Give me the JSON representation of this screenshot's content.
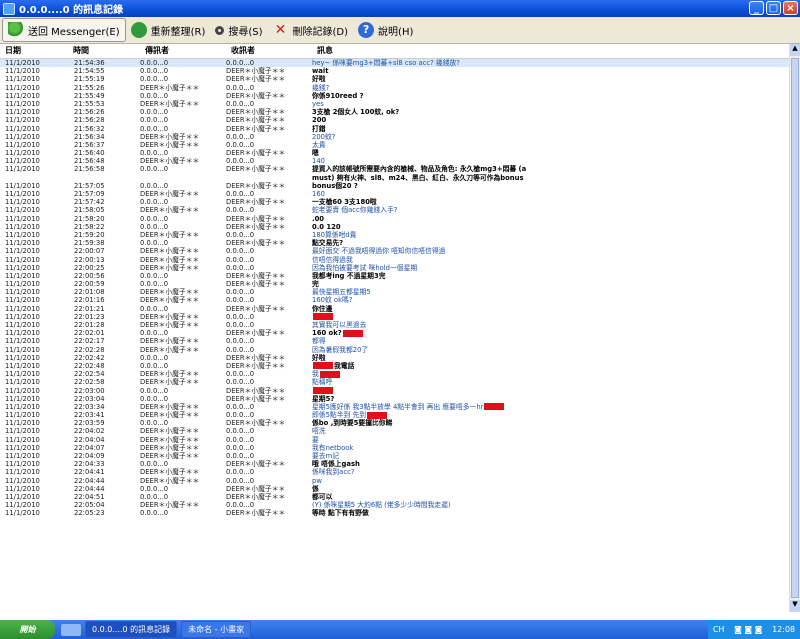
{
  "window": {
    "title": "0.0.0....0 的訊息記錄"
  },
  "toolbar": {
    "back": "送回 Messenger(E)",
    "refresh": "重新整理(R)",
    "search": "搜尋(S)",
    "delete": "刪除記錄(D)",
    "help": "說明(H)"
  },
  "columns": {
    "date": "日期",
    "time": "時間",
    "from": "傳訊者",
    "to": "收訊者",
    "msg": "訊息"
  },
  "rows": [
    {
      "d": "11/1/2010",
      "t": "21:54:36",
      "f": "0.0.0...0",
      "r": "0.0.0...0",
      "m": "hey~ 係咪要mg3+悶蕃+sl8 cso acc? 幾錢放?",
      "b": false,
      "s": true
    },
    {
      "d": "11/1/2010",
      "t": "21:54:55",
      "f": "0.0.0...0",
      "r": "DEER＊小魔子＊＊",
      "m": "wait",
      "b": true
    },
    {
      "d": "11/1/2010",
      "t": "21:55:19",
      "f": "0.0.0...0",
      "r": "DEER＊小魔子＊＊",
      "m": "好啦",
      "b": true
    },
    {
      "d": "11/1/2010",
      "t": "21:55:26",
      "f": "DEER＊小魔子＊＊",
      "r": "0.0.0...0",
      "m": "幾錢?",
      "b": false
    },
    {
      "d": "11/1/2010",
      "t": "21:55:49",
      "f": "0.0.0...0",
      "r": "DEER＊小魔子＊＊",
      "m": "你係910reed ?",
      "b": true
    },
    {
      "d": "11/1/2010",
      "t": "21:55:53",
      "f": "DEER＊小魔子＊＊",
      "r": "0.0.0...0",
      "m": "yes",
      "b": false
    },
    {
      "d": "11/1/2010",
      "t": "21:56:26",
      "f": "0.0.0...0",
      "r": "DEER＊小魔子＊＊",
      "m": "3支槍 2個女人 100蚊, ok?",
      "b": true
    },
    {
      "d": "11/1/2010",
      "t": "21:56:28",
      "f": "0.0.0...0",
      "r": "DEER＊小魔子＊＊",
      "m": "200",
      "b": true
    },
    {
      "d": "11/1/2010",
      "t": "21:56:32",
      "f": "0.0.0...0",
      "r": "DEER＊小魔子＊＊",
      "m": "打錯",
      "b": true
    },
    {
      "d": "11/1/2010",
      "t": "21:56:34",
      "f": "DEER＊小魔子＊＊",
      "r": "0.0.0...0",
      "m": "200蚊?",
      "b": false
    },
    {
      "d": "11/1/2010",
      "t": "21:56:37",
      "f": "DEER＊小魔子＊＊",
      "r": "0.0.0...0",
      "m": "太貴",
      "b": false
    },
    {
      "d": "11/1/2010",
      "t": "21:56:40",
      "f": "0.0.0...0",
      "r": "DEER＊小魔子＊＊",
      "m": "嗯",
      "b": true
    },
    {
      "d": "11/1/2010",
      "t": "21:56:48",
      "f": "DEER＊小魔子＊＊",
      "r": "0.0.0...0",
      "m": "140",
      "b": false
    },
    {
      "d": "11/1/2010",
      "t": "21:56:58",
      "f": "0.0.0...0",
      "r": "DEER＊小魔子＊＊",
      "m": "提買入的該帳號所需要內含的槍械、物品及角色: 永久槍mg3+悶蕃 (a",
      "b": true
    },
    {
      "d": "",
      "t": "",
      "f": "",
      "r": "",
      "m": "must) 夠有火神、sl8、m24、黑白、紅白、永久刀等可作為bonus",
      "b": true
    },
    {
      "d": "11/1/2010",
      "t": "21:57:05",
      "f": "0.0.0...0",
      "r": "DEER＊小魔子＊＊",
      "m": "bonus個20 ?",
      "b": true
    },
    {
      "d": "11/1/2010",
      "t": "21:57:09",
      "f": "DEER＊小魔子＊＊",
      "r": "0.0.0...0",
      "m": "160",
      "b": false
    },
    {
      "d": "11/1/2010",
      "t": "21:57:42",
      "f": "0.0.0...0",
      "r": "DEER＊小魔子＊＊",
      "m": "一支槍60 3支180啦",
      "b": true
    },
    {
      "d": "11/1/2010",
      "t": "21:58:05",
      "f": "DEER＊小魔子＊＊",
      "r": "0.0.0...0",
      "m": "蛇老要賣 個acc你幾錢入手?",
      "b": false
    },
    {
      "d": "11/1/2010",
      "t": "21:58:20",
      "f": "0.0.0...0",
      "r": "DEER＊小魔子＊＊",
      "m": ".00",
      "b": true
    },
    {
      "d": "11/1/2010",
      "t": "21:58:22",
      "f": "0.0.0...0",
      "r": "DEER＊小魔子＊＊",
      "m": "0.0 120",
      "b": true
    },
    {
      "d": "11/1/2010",
      "t": "21:59:20",
      "f": "DEER＊小魔子＊＊",
      "r": "0.0.0...0",
      "m": "180算係咁d貴",
      "b": false
    },
    {
      "d": "11/1/2010",
      "t": "21:59:38",
      "f": "0.0.0...0",
      "r": "DEER＊小魔子＊＊",
      "m": "點交易先?",
      "b": true
    },
    {
      "d": "11/1/2010",
      "t": "22:00:07",
      "f": "DEER＊小魔子＊＊",
      "r": "0.0.0...0",
      "m": "最好面交 不過我唔得過你 唔知你信唔信得過",
      "b": false
    },
    {
      "d": "11/1/2010",
      "t": "22:00:13",
      "f": "DEER＊小魔子＊＊",
      "r": "0.0.0...0",
      "m": "信唔信得過我",
      "b": false
    },
    {
      "d": "11/1/2010",
      "t": "22:00:25",
      "f": "DEER＊小魔子＊＊",
      "r": "0.0.0...0",
      "m": "因為我怕被要考試 咪hold一個星期",
      "b": false
    },
    {
      "d": "11/1/2010",
      "t": "22:00:56",
      "f": "0.0.0...0",
      "r": "DEER＊小魔子＊＊",
      "m": "我都考ing 不過星期3完",
      "b": true
    },
    {
      "d": "11/1/2010",
      "t": "22:00:59",
      "f": "0.0.0...0",
      "r": "DEER＊小魔子＊＊",
      "m": "完",
      "b": true
    },
    {
      "d": "11/1/2010",
      "t": "22:01:08",
      "f": "DEER＊小魔子＊＊",
      "r": "0.0.0...0",
      "m": "最快星期五都星期5",
      "b": false
    },
    {
      "d": "11/1/2010",
      "t": "22:01:16",
      "f": "DEER＊小魔子＊＊",
      "r": "0.0.0...0",
      "m": "160蚊 ok嗎?",
      "b": false
    },
    {
      "d": "11/1/2010",
      "t": "22:01:21",
      "f": "0.0.0...0",
      "r": "DEER＊小魔子＊＊",
      "m": "你住邊",
      "b": true
    },
    {
      "d": "11/1/2010",
      "t": "22:01:23",
      "f": "DEER＊小魔子＊＊",
      "r": "0.0.0...0",
      "m": "",
      "x": "pre",
      "b": false
    },
    {
      "d": "11/1/2010",
      "t": "22:01:28",
      "f": "DEER＊小魔子＊＊",
      "r": "0.0.0...0",
      "m": "其實我可以黑過去",
      "b": false
    },
    {
      "d": "11/1/2010",
      "t": "22:02:01",
      "f": "0.0.0...0",
      "r": "DEER＊小魔子＊＊",
      "m": "160 ok?",
      "x": "mid",
      "b": true
    },
    {
      "d": "11/1/2010",
      "t": "22:02:17",
      "f": "DEER＊小魔子＊＊",
      "r": "0.0.0...0",
      "m": "都得",
      "b": false
    },
    {
      "d": "11/1/2010",
      "t": "22:02:28",
      "f": "DEER＊小魔子＊＊",
      "r": "0.0.0...0",
      "m": "因為暑假我都20了",
      "b": false
    },
    {
      "d": "11/1/2010",
      "t": "22:02:42",
      "f": "0.0.0...0",
      "r": "DEER＊小魔子＊＊",
      "m": "好啦",
      "b": true
    },
    {
      "d": "11/1/2010",
      "t": "22:02:48",
      "f": "0.0.0...0",
      "r": "DEER＊小魔子＊＊",
      "m": "我電話",
      "x": "pre",
      "b": true
    },
    {
      "d": "11/1/2010",
      "t": "22:02:54",
      "f": "DEER＊小魔子＊＊",
      "r": "0.0.0...0",
      "m": "我",
      "x": "post",
      "b": false
    },
    {
      "d": "11/1/2010",
      "t": "22:02:58",
      "f": "DEER＊小魔子＊＊",
      "r": "0.0.0...0",
      "m": "點稱呼",
      "b": false
    },
    {
      "d": "11/1/2010",
      "t": "22:03:00",
      "f": "0.0.0...0",
      "r": "DEER＊小魔子＊＊",
      "m": "",
      "x": "pre",
      "b": true
    },
    {
      "d": "11/1/2010",
      "t": "22:03:04",
      "f": "0.0.0...0",
      "r": "DEER＊小魔子＊＊",
      "m": "星期5?",
      "b": true
    },
    {
      "d": "11/1/2010",
      "t": "22:03:34",
      "f": "DEER＊小魔子＊＊",
      "r": "0.0.0...0",
      "m": "星期5應好係 我3點半放學 4點半會到 再出 應要唔多一hr",
      "x": "mid",
      "b": false
    },
    {
      "d": "11/1/2010",
      "t": "22:03:41",
      "f": "DEER＊小魔子＊＊",
      "r": "0.0.0...0",
      "m": "即係5點半到 先到",
      "x": "post",
      "b": false
    },
    {
      "d": "11/1/2010",
      "t": "22:03:59",
      "f": "0.0.0...0",
      "r": "DEER＊小魔子＊＊",
      "m": "係bo ,到時要5要攞比你睇",
      "b": true
    },
    {
      "d": "11/1/2010",
      "t": "22:04:02",
      "f": "DEER＊小魔子＊＊",
      "r": "0.0.0...0",
      "m": "唔洗",
      "b": false
    },
    {
      "d": "11/1/2010",
      "t": "22:04:04",
      "f": "DEER＊小魔子＊＊",
      "r": "0.0.0...0",
      "m": "要",
      "b": false
    },
    {
      "d": "11/1/2010",
      "t": "22:04:07",
      "f": "DEER＊小魔子＊＊",
      "r": "0.0.0...0",
      "m": "我有netbook",
      "b": false
    },
    {
      "d": "11/1/2010",
      "t": "22:04:09",
      "f": "DEER＊小魔子＊＊",
      "r": "0.0.0...0",
      "m": "要去m記",
      "b": false
    },
    {
      "d": "11/1/2010",
      "t": "22:04:33",
      "f": "0.0.0...0",
      "r": "DEER＊小魔子＊＊",
      "m": "哦 唔係上gash",
      "b": true
    },
    {
      "d": "11/1/2010",
      "t": "22:04:41",
      "f": "DEER＊小魔子＊＊",
      "r": "0.0.0...0",
      "m": "係咪我到acc?",
      "b": false
    },
    {
      "d": "11/1/2010",
      "t": "22:04:44",
      "f": "DEER＊小魔子＊＊",
      "r": "0.0.0...0",
      "m": "pw",
      "b": false
    },
    {
      "d": "11/1/2010",
      "t": "22:04:44",
      "f": "0.0.0...0",
      "r": "DEER＊小魔子＊＊",
      "m": "係",
      "b": true
    },
    {
      "d": "11/1/2010",
      "t": "22:04:51",
      "f": "0.0.0...0",
      "r": "DEER＊小魔子＊＊",
      "m": "都可以",
      "b": true
    },
    {
      "d": "11/1/2010",
      "t": "22:05:04",
      "f": "DEER＊小魔子＊＊",
      "r": "0.0.0...0",
      "m": "(Y) 係咪星期5 大約6點 (佬多少少時間我走遲)",
      "b": false
    },
    {
      "d": "11/1/2010",
      "t": "22:05:23",
      "f": "0.0.0...0",
      "r": "DEER＊小魔子＊＊",
      "m": "等時 點下有有野做",
      "b": true
    }
  ],
  "taskbar": {
    "start": "開始",
    "task1": "0.0.0....0 的訊息記錄",
    "task2": "未命名 - 小畫家",
    "lang": "CH",
    "clock": "12:08"
  },
  "colors": {
    "redaction": "#e0101a",
    "titlebar": "#0a4fd6",
    "message_blue": "#2050a8"
  }
}
